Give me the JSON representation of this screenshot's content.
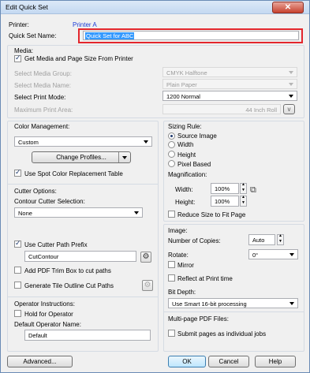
{
  "window": {
    "title": "Edit Quick Set",
    "close_label": "✕"
  },
  "printer": {
    "label": "Printer:",
    "value": "Printer A"
  },
  "quick_set_name": {
    "label": "Quick Set Name:",
    "value": "Quick Set for ABC"
  },
  "media": {
    "heading": "Media:",
    "get_media_label": "Get Media and Page Size From Printer",
    "media_group": {
      "label": "Select Media Group:",
      "value": "CMYK Halftone"
    },
    "media_name": {
      "label": "Select Media Name:",
      "value": "Plain Paper"
    },
    "print_mode": {
      "label": "Select Print Mode:",
      "value": "1200 Normal"
    },
    "max_area": {
      "label": "Maximum Print Area:",
      "value": "44 Inch Roll",
      "button": "v"
    }
  },
  "color_management": {
    "heading": "Color Management:",
    "value": "Custom",
    "change_profiles": "Change Profiles...",
    "spot_color_label": "Use Spot Color Replacement Table"
  },
  "sizing": {
    "heading": "Sizing Rule:",
    "options": [
      "Source Image",
      "Width",
      "Height",
      "Pixel Based"
    ],
    "magnification": "Magnification:",
    "width_label": "Width:",
    "width_value": "100%",
    "height_label": "Height:",
    "height_value": "100%",
    "reduce_label": "Reduce Size to Fit Page"
  },
  "cutter": {
    "heading": "Cutter Options:",
    "contour_label": "Contour Cutter Selection:",
    "contour_value": "None",
    "prefix_label": "Use Cutter Path Prefix",
    "prefix_value": "CutContour",
    "trim_label": "Add PDF Trim Box to cut paths",
    "tile_label": "Generate Tile Outline Cut Paths"
  },
  "image": {
    "heading": "Image:",
    "copies_label": "Number of Copies:",
    "copies_value": "Auto",
    "rotate_label": "Rotate:",
    "rotate_value": "0°",
    "mirror_label": "Mirror",
    "reflect_label": "Reflect at Print time",
    "bit_depth_label": "Bit Depth:",
    "bit_depth_value": "Use Smart 16-bit processing"
  },
  "multipage": {
    "heading": "Multi-page PDF Files:",
    "submit_label": "Submit pages as individual jobs"
  },
  "operator": {
    "heading": "Operator Instructions:",
    "hold_label": "Hold for Operator",
    "default_name_label": "Default Operator Name:",
    "default_name_value": "Default"
  },
  "footer": {
    "advanced": "Advanced...",
    "ok": "OK",
    "cancel": "Cancel",
    "help": "Help"
  },
  "colors": {
    "highlight_border": "#e3262c",
    "printer_value": "#1a3bd6",
    "selection": "#3399ff"
  }
}
